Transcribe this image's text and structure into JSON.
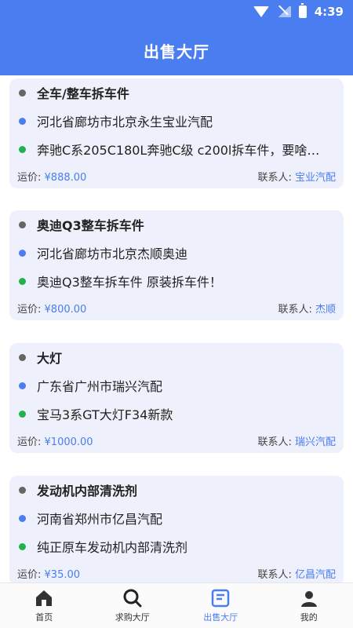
{
  "status_bar": {
    "time": "4:39"
  },
  "header": {
    "title": "出售大厅"
  },
  "cards": [
    {
      "title": "全车/整车拆车件",
      "location": "河北省廊坊市北京永生宝业汽配",
      "description": "奔驰C系205C180L奔驰C级 c200l拆车件，要啥…",
      "price_label": "运价:",
      "price": "¥888.00",
      "contact_label": "联系人:",
      "contact": "宝业汽配"
    },
    {
      "title": "奥迪Q3整车拆车件",
      "location": "河北省廊坊市北京杰顺奥迪",
      "description": "奥迪Q3整车拆车件 原装拆车件！",
      "price_label": "运价:",
      "price": "¥800.00",
      "contact_label": "联系人:",
      "contact": "杰顺"
    },
    {
      "title": "大灯",
      "location": "广东省广州市瑞兴汽配",
      "description": "宝马3系GT大灯F34新款",
      "price_label": "运价:",
      "price": "¥1000.00",
      "contact_label": "联系人:",
      "contact": "瑞兴汽配"
    },
    {
      "title": "发动机内部清洗剂",
      "location": "河南省郑州市亿昌汽配",
      "description": "纯正原车发动机内部清洗剂",
      "price_label": "运价:",
      "price": "¥35.00",
      "contact_label": "联系人:",
      "contact": "亿昌汽配"
    }
  ],
  "bottom_nav": [
    {
      "label": "首页",
      "icon": "home-icon",
      "active": false
    },
    {
      "label": "求购大厅",
      "icon": "search-icon",
      "active": false
    },
    {
      "label": "出售大厅",
      "icon": "sell-icon",
      "active": true
    },
    {
      "label": "我的",
      "icon": "user-icon",
      "active": false
    }
  ],
  "colors": {
    "accent": "#4a7df0",
    "card_bg": "#eef0fb",
    "green_dot": "#22b14c",
    "gray_dot": "#666666"
  }
}
